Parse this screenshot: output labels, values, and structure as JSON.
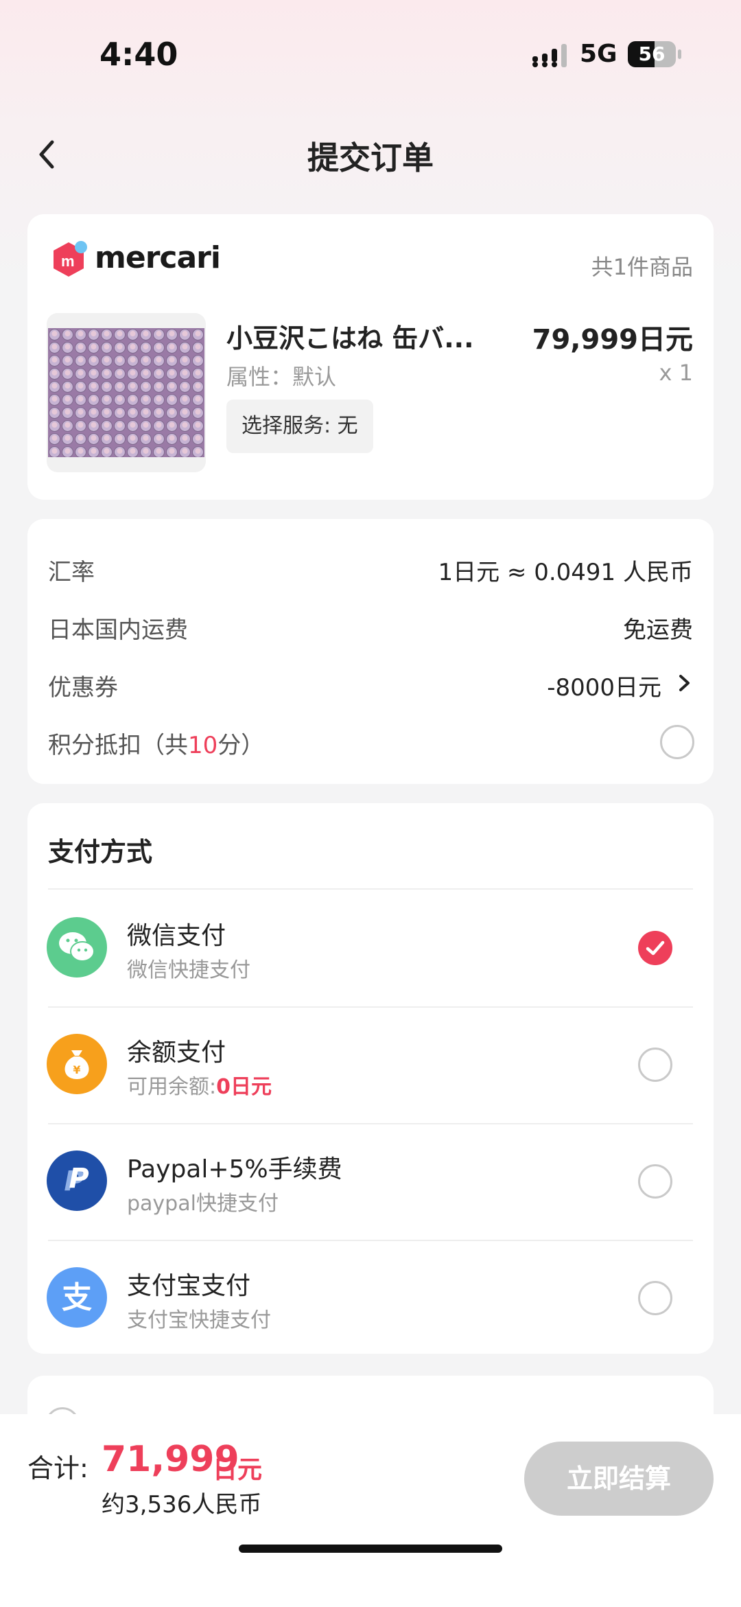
{
  "status_bar": {
    "time": "4:40",
    "network": "5G",
    "battery": "56",
    "battery_level": 0.56
  },
  "nav": {
    "title": "提交订单",
    "back_icon": "chevron-left-icon"
  },
  "order": {
    "brand": "mercari",
    "item_count": "共1件商品",
    "product": {
      "name": "小豆沢こはね 缶バ...",
      "price": "79,999日元",
      "attribute": "属性：默认",
      "quantity": "x 1",
      "service": "选择服务: 无"
    }
  },
  "fees": {
    "exchange_label": "汇率",
    "exchange_value": "1日元 ≈ 0.0491 人民币",
    "shipping_label": "日本国内运费",
    "shipping_value": "免运费",
    "coupon_label": "优惠券",
    "coupon_value": "-8000日元",
    "points_prefix": "积分抵扣（共",
    "points_count": "10",
    "points_suffix": "分）"
  },
  "payment": {
    "title": "支付方式",
    "methods": [
      {
        "name": "微信支付",
        "subtitle": "微信快捷支付",
        "icon": "wechat-pay-icon",
        "color": "#5ccc8e",
        "selected": true
      },
      {
        "name": "余额支付",
        "subtitle_prefix": "可用余额:",
        "subtitle_value": "0日元",
        "icon": "money-bag-icon",
        "color": "#f7a01c",
        "selected": false
      },
      {
        "name": "Paypal+5%手续费",
        "subtitle": "paypal快捷支付",
        "icon": "paypal-icon",
        "color": "#1f4fa8",
        "selected": false
      },
      {
        "name": "支付宝支付",
        "subtitle": "支付宝快捷支付",
        "icon": "alipay-icon",
        "color": "#5d9ff6",
        "selected": false
      }
    ]
  },
  "footer": {
    "total_label": "合计:",
    "total_amount": "71,999",
    "total_unit": "日元",
    "total_rmb": "约3,536人民币",
    "checkout_label": "立即结算"
  },
  "colors": {
    "accent": "#ee3f5a",
    "disabled_button": "#cdcdcd"
  }
}
